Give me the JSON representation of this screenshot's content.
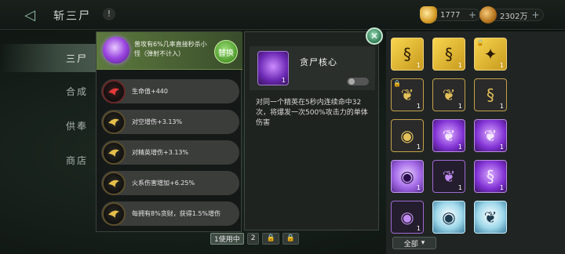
{
  "header": {
    "title": "斩三尸",
    "info_glyph": "!",
    "back_glyph": "◁",
    "currency_1": {
      "value": "1777",
      "icon": "gold-ingot-icon"
    },
    "currency_2": {
      "value": "2302万",
      "icon": "copper-coin-icon"
    },
    "plus_glyph": "+"
  },
  "menu": {
    "items": [
      {
        "label": "三尸",
        "active": true
      },
      {
        "label": "合成",
        "active": false
      },
      {
        "label": "供奉",
        "active": false
      },
      {
        "label": "商店",
        "active": false
      }
    ]
  },
  "hint": {
    "text": "普攻有6%几率直接秒杀小怪（弹射不计入）",
    "replace_label": "替换"
  },
  "stats": [
    {
      "text": "生命值+440",
      "icon": "red-bird-icon"
    },
    {
      "text": "对空增伤+3.13%",
      "icon": "gold-bird-icon"
    },
    {
      "text": "对精英增伤+3.13%",
      "icon": "gold-bird-icon"
    },
    {
      "text": "火系伤害增加+6.25%",
      "icon": "gold-bird-icon"
    },
    {
      "text": "每拥有8%贪财，获得1.5%增伤",
      "icon": "gold-bird-icon"
    }
  ],
  "pager": {
    "in_use": "1使用中",
    "page_2": "2",
    "lock_glyph": "🔒"
  },
  "detail": {
    "name": "贪尸核心",
    "qty": "1",
    "description": "对同一个精英在5秒内连续命中32次，将爆发一次500%攻击力的单体伤害",
    "close_glyph": "✕"
  },
  "inventory": {
    "slots": [
      {
        "style": "gold",
        "glyph": "§",
        "qty": "1",
        "locked": false
      },
      {
        "style": "gold",
        "glyph": "§",
        "qty": "1",
        "locked": false
      },
      {
        "style": "gold",
        "glyph": "✦",
        "qty": "1",
        "locked": true
      },
      {
        "style": "dark",
        "glyph": "❦",
        "qty": "1",
        "locked": true
      },
      {
        "style": "dark",
        "glyph": "❦",
        "qty": "1",
        "locked": false
      },
      {
        "style": "dark",
        "glyph": "§",
        "qty": "1",
        "locked": false
      },
      {
        "style": "dark",
        "glyph": "◉",
        "qty": "1",
        "locked": false
      },
      {
        "style": "purple",
        "glyph": "❦",
        "qty": "1",
        "locked": false
      },
      {
        "style": "purple",
        "glyph": "❦",
        "qty": "1",
        "locked": false
      },
      {
        "style": "violet",
        "glyph": "◉",
        "qty": "1",
        "locked": false
      },
      {
        "style": "dark-violet",
        "glyph": "❦",
        "qty": "1",
        "locked": false
      },
      {
        "style": "purple",
        "glyph": "§",
        "qty": "1",
        "locked": false
      },
      {
        "style": "dark-violet",
        "glyph": "◉",
        "qty": "1",
        "locked": false
      },
      {
        "style": "ice",
        "glyph": "◉",
        "qty": "",
        "locked": false
      },
      {
        "style": "ice",
        "glyph": "❦",
        "qty": "",
        "locked": false
      }
    ],
    "filter_label": "全部",
    "filter_glyph": "▾"
  }
}
